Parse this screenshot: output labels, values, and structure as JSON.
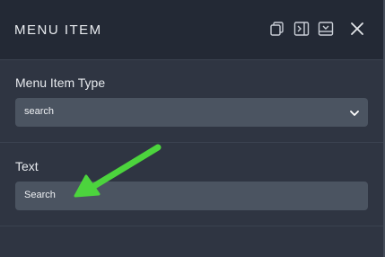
{
  "header": {
    "title": "MENU ITEM",
    "icons": [
      "copy-icon",
      "panel-collapse-icon",
      "save-icon",
      "close-icon"
    ]
  },
  "menu_item_type": {
    "label": "Menu Item Type",
    "value": "search",
    "icon": "chevron-down-icon"
  },
  "text_field": {
    "label": "Text",
    "value": "Search"
  },
  "colors": {
    "header_bg": "#232935",
    "panel_bg": "#2f3542",
    "field_bg": "#4b5461",
    "arrow": "#4cd43d"
  }
}
